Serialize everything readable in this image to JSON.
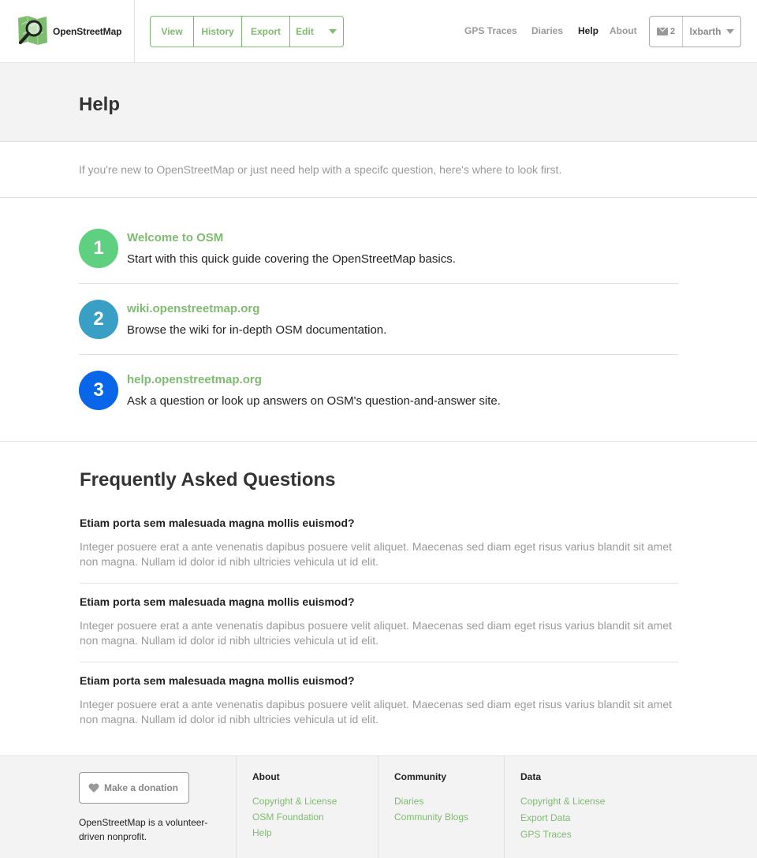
{
  "header": {
    "brand_name": "OpenStreetMap",
    "tabs": {
      "view": "View",
      "history": "History",
      "export": "Export",
      "edit": "Edit"
    },
    "nav": {
      "gps_traces": "GPS Traces",
      "diaries": "Diaries",
      "help": "Help",
      "about": "About"
    },
    "active_nav": "Help",
    "messages_count": "2",
    "username": "lxbarth"
  },
  "page": {
    "title": "Help",
    "intro": "If you're new to OpenStreetMap or just need help with a specifc question, here's where to look first."
  },
  "steps": [
    {
      "number": "1",
      "link": "Welcome to OSM",
      "description": "Start with this quick guide covering the OpenStreetMap basics.",
      "color": "#5fcf80"
    },
    {
      "number": "2",
      "link": "wiki.openstreetmap.org",
      "description": "Browse the wiki for in-depth OSM documentation.",
      "color": "#3a9fc4"
    },
    {
      "number": "3",
      "link": "help.openstreetmap.org",
      "description": "Ask a question or look up answers on OSM's question-and-answer site.",
      "color": "#0966e9"
    }
  ],
  "faq": {
    "title": "Frequently Asked Questions",
    "items": [
      {
        "question": "Etiam porta sem malesuada magna mollis euismod?",
        "answer": "Integer posuere erat a ante venenatis dapibus posuere velit aliquet. Maecenas sed diam eget risus varius blandit sit amet non magna. Nullam id dolor id nibh ultricies vehicula ut id elit."
      },
      {
        "question": "Etiam porta sem malesuada magna mollis euismod?",
        "answer": "Integer posuere erat a ante venenatis dapibus posuere velit aliquet. Maecenas sed diam eget risus varius blandit sit amet non magna. Nullam id dolor id nibh ultricies vehicula ut id elit."
      },
      {
        "question": "Etiam porta sem malesuada magna mollis euismod?",
        "answer": "Integer posuere erat a ante venenatis dapibus posuere velit aliquet. Maecenas sed diam eget risus varius blandit sit amet non magna. Nullam id dolor id nibh ultricies vehicula ut id elit."
      }
    ]
  },
  "footer": {
    "donate_label": "Make a donation",
    "note": "OpenStreetMap is a volunteer-driven nonprofit.",
    "columns": {
      "about": {
        "title": "About",
        "links": [
          "Copyright & License",
          "OSM Foundation",
          "Help"
        ]
      },
      "community": {
        "title": "Community",
        "links": [
          "Diaries",
          "Community Blogs"
        ]
      },
      "data": {
        "title": "Data",
        "links": [
          "Copyright & License",
          "Export Data",
          "GPS Traces"
        ]
      }
    }
  },
  "colors": {
    "accent_green": "#7ebc6f",
    "text_muted": "#9a9a9a",
    "band_grey": "#f3f3f3"
  },
  "icons": [
    "osm-logo-icon",
    "chevron-down-icon",
    "envelope-icon",
    "heart-icon"
  ]
}
